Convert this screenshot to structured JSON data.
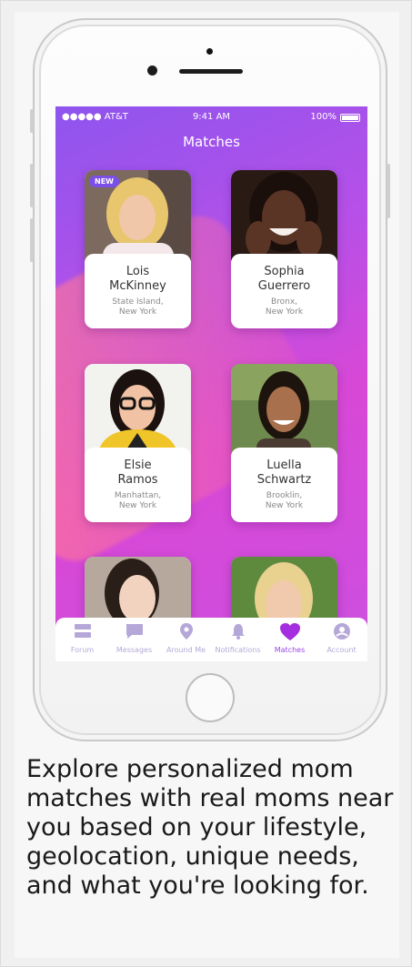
{
  "status_bar": {
    "carrier": "●●●●● AT&T",
    "time": "9:41 AM",
    "battery": "100%"
  },
  "screen": {
    "title": "Matches"
  },
  "matches": [
    {
      "name_line1": "Lois",
      "name_line2": "McKinney",
      "loc_line1": "State Island,",
      "loc_line2": "New York",
      "badge": "NEW",
      "photo": "woman-blonde-icon"
    },
    {
      "name_line1": "Sophia",
      "name_line2": "Guerrero",
      "loc_line1": "Bronx,",
      "loc_line2": "New York",
      "photo": "woman-smiling-icon"
    },
    {
      "name_line1": "Elsie",
      "name_line2": "Ramos",
      "loc_line1": "Manhattan,",
      "loc_line2": "New York",
      "photo": "woman-glasses-icon"
    },
    {
      "name_line1": "Luella",
      "name_line2": "Schwartz",
      "loc_line1": "Brooklin,",
      "loc_line2": "New York",
      "photo": "woman-outdoor-icon"
    }
  ],
  "tabs": [
    {
      "label": "Forum",
      "icon": "forum-icon"
    },
    {
      "label": "Messages",
      "icon": "message-icon"
    },
    {
      "label": "Around Me",
      "icon": "location-pin-icon"
    },
    {
      "label": "Notifications",
      "icon": "bell-icon"
    },
    {
      "label": "Matches",
      "icon": "heart-icon",
      "active": true
    },
    {
      "label": "Account",
      "icon": "account-icon"
    }
  ],
  "caption": "Explore personalized mom matches with real moms near you based on your lifestyle, geolocation, unique needs, and what you're looking for.",
  "colors": {
    "accent": "#9a45e8",
    "gradient_start": "#8e55ee",
    "gradient_end": "#d848d6",
    "badge": "#7b4fe8"
  }
}
